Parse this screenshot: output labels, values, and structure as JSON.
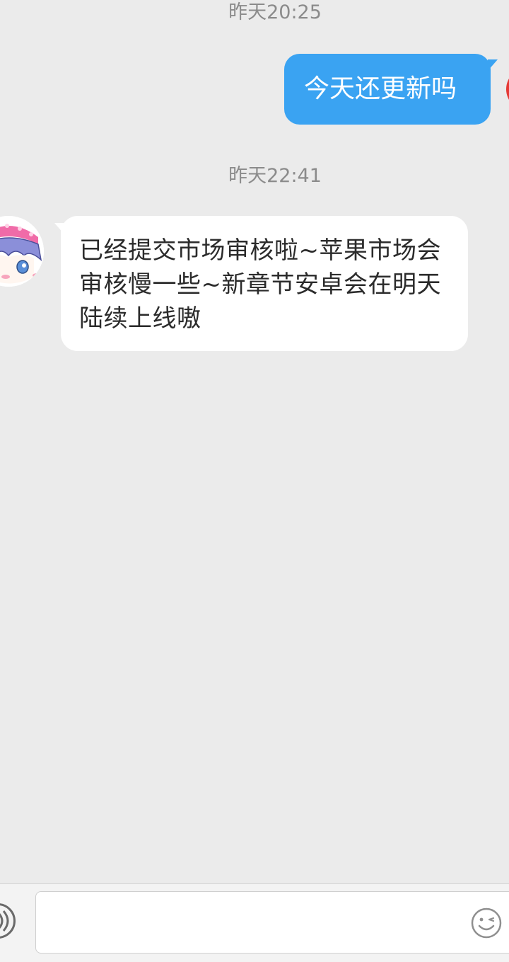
{
  "conversation": {
    "messages": [
      {
        "timestamp": "昨天20:25",
        "direction": "outgoing",
        "text": "今天还更新吗"
      },
      {
        "timestamp": "昨天22:41",
        "direction": "incoming",
        "text": "已经提交市场审核啦~苹果市场会审核慢一些~新章节安卓会在明天陆续上线嗷"
      }
    ]
  },
  "composer": {
    "input_value": "",
    "voice_icon": "voice-icon",
    "emoji_icon": "emoji-smile-icon"
  },
  "colors": {
    "background": "#ebebeb",
    "outgoing_bubble": "#3aa3f2",
    "incoming_bubble": "#ffffff",
    "timestamp_text": "#8b8b8b"
  }
}
